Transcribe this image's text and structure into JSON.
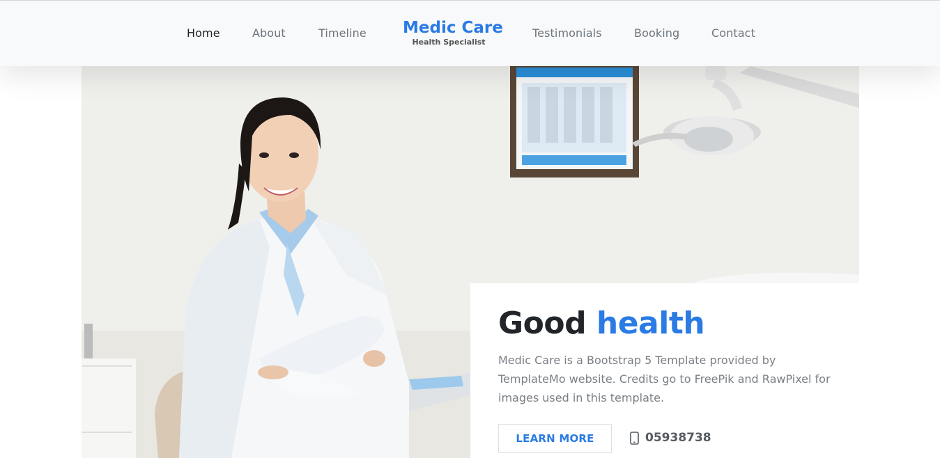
{
  "nav": {
    "items": [
      {
        "label": "Home",
        "active": true
      },
      {
        "label": "About"
      },
      {
        "label": "Timeline"
      },
      {
        "label": "Testimonials"
      },
      {
        "label": "Booking"
      },
      {
        "label": "Contact"
      }
    ],
    "brand": {
      "title": "Medic Care",
      "subtitle": "Health Specialist"
    }
  },
  "hero": {
    "headline_start": "Good ",
    "headline_accent": "health",
    "description": "Medic Care is a Bootstrap 5 Template provided by TemplateMo website. Credits go to FreePik and RawPixel for images used in this template.",
    "button_label": "LEARN MORE",
    "phone": "05938738",
    "phone_icon": "phone-icon"
  },
  "colors": {
    "accent": "#2a7be4",
    "text_dark": "#212529",
    "text_muted": "#7a7f85",
    "nav_bg": "#f8f9fa"
  }
}
